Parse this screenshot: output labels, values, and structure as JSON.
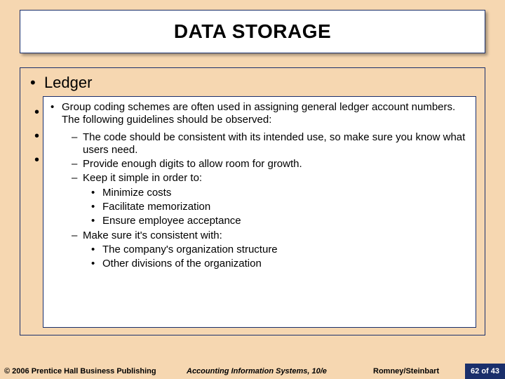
{
  "title": "DATA STORAGE",
  "ledger_label": "Ledger",
  "main_point": "Group coding schemes are often used in assigning general ledger account numbers.  The following guidelines should be observed:",
  "sub": {
    "a": "The code should be consistent with its intended use, so make sure you know what users need.",
    "b": "Provide enough digits to allow room for growth.",
    "c": "Keep it simple in order to:",
    "c_items": {
      "i": "Minimize costs",
      "ii": "Facilitate memorization",
      "iii": "Ensure employee acceptance"
    },
    "d": "Make sure it's consistent with:",
    "d_items": {
      "i": "The company's organization structure",
      "ii": "Other divisions of the organization"
    }
  },
  "footer": {
    "copyright": "© 2006 Prentice Hall Business Publishing",
    "book": "Accounting Information Systems, 10/e",
    "authors": "Romney/Steinbart",
    "page": "62 of 43"
  }
}
